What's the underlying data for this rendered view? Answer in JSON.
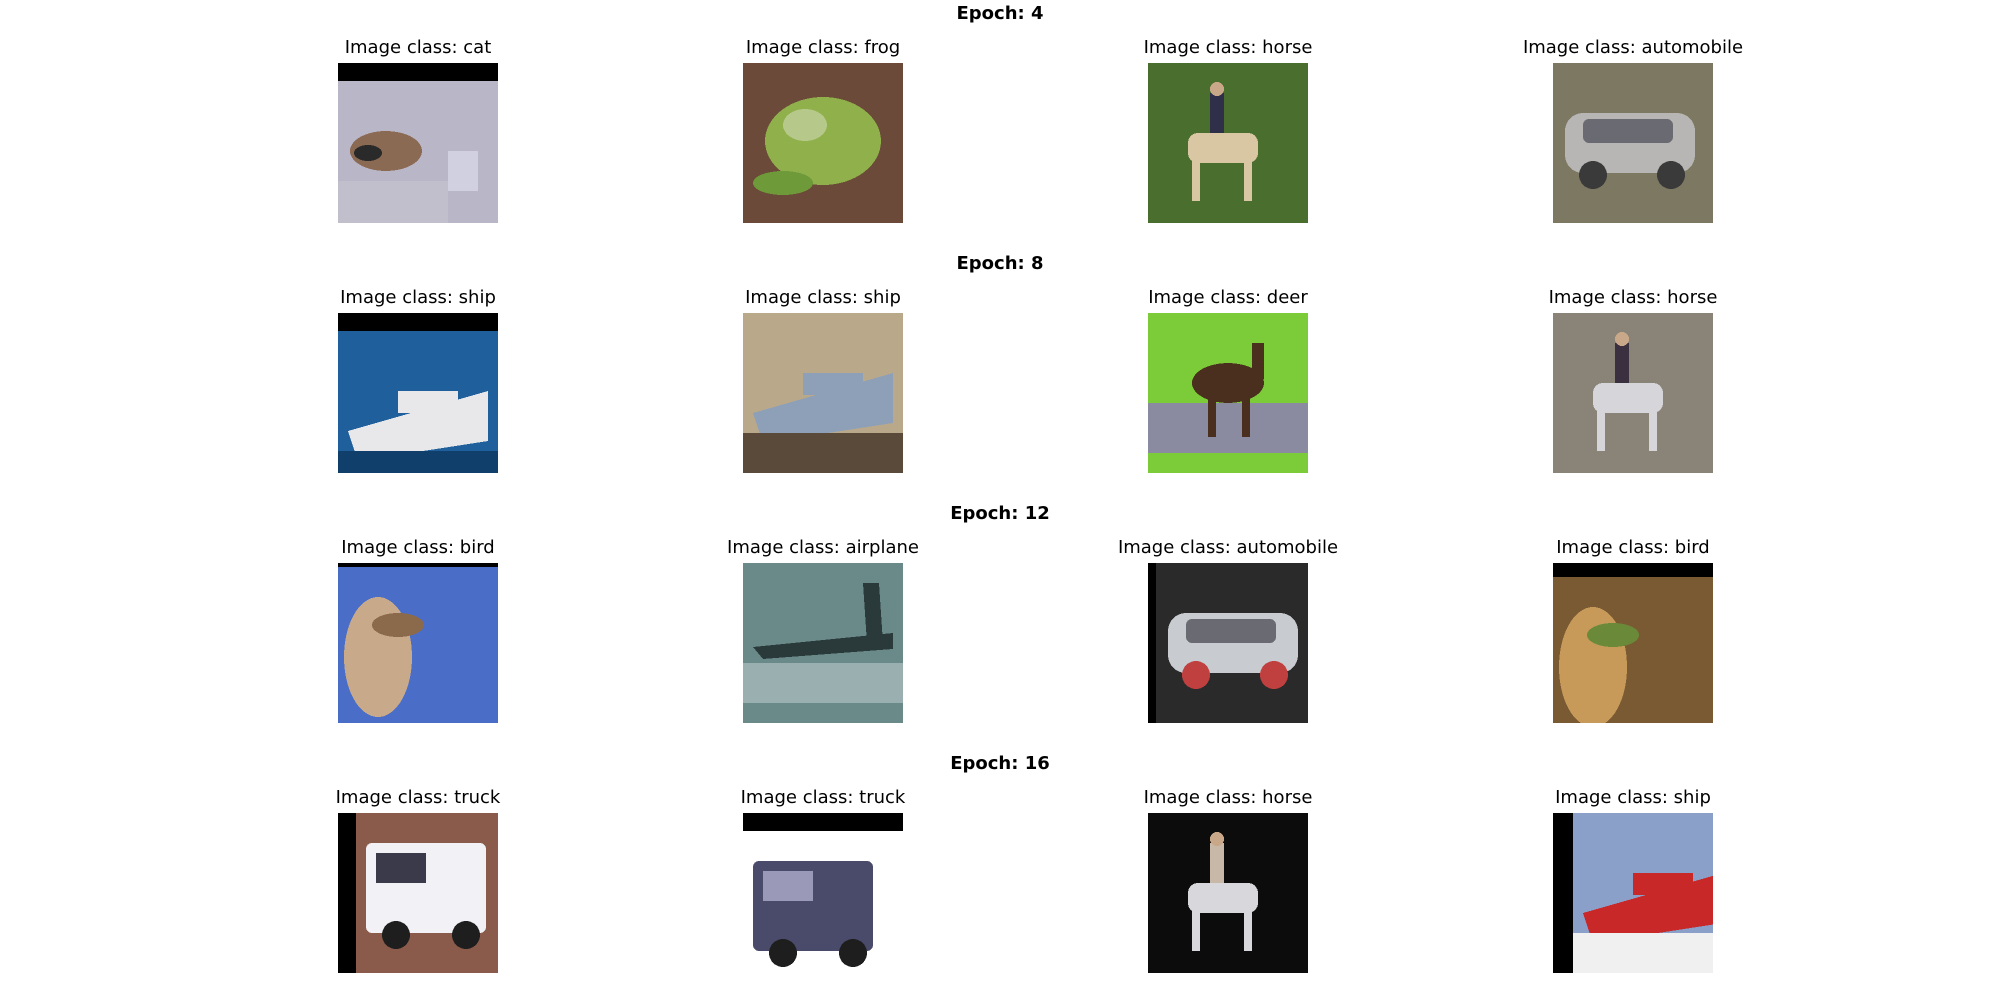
{
  "figure": {
    "rows": [
      {
        "title": "Epoch: 4",
        "cells": [
          {
            "label": "Image class: cat",
            "subject": "cat",
            "bg": "#b9b6c8",
            "fg": "#8a6a52",
            "accent": "#2a2a2a"
          },
          {
            "label": "Image class: frog",
            "subject": "frog",
            "bg": "#6b4a3a",
            "fg": "#8fb04a",
            "accent": "#b6c98a"
          },
          {
            "label": "Image class: horse",
            "subject": "horse",
            "bg": "#4a6e2e",
            "fg": "#d8c7a2",
            "accent": "#2f2f4a"
          },
          {
            "label": "Image class: automobile",
            "subject": "automobile",
            "bg": "#7c7862",
            "fg": "#b8b6b4",
            "accent": "#3a3a3a"
          }
        ]
      },
      {
        "title": "Epoch: 8",
        "cells": [
          {
            "label": "Image class: ship",
            "subject": "ship",
            "bg": "#1f5f9c",
            "fg": "#e8e8ea",
            "accent": "#0f3f6a"
          },
          {
            "label": "Image class: ship",
            "subject": "ship",
            "bg": "#b9a98a",
            "fg": "#8ea0b8",
            "accent": "#5a4a3a"
          },
          {
            "label": "Image class: deer",
            "subject": "deer",
            "bg": "#7ccc3a",
            "fg": "#4a2e1e",
            "accent": "#8a8aa0"
          },
          {
            "label": "Image class: horse",
            "subject": "horse",
            "bg": "#8a8478",
            "fg": "#d6d6da",
            "accent": "#3a3040"
          }
        ]
      },
      {
        "title": "Epoch: 12",
        "cells": [
          {
            "label": "Image class: bird",
            "subject": "bird",
            "bg": "#4a6ec8",
            "fg": "#c8aa8a",
            "accent": "#8a6a4a"
          },
          {
            "label": "Image class: airplane",
            "subject": "airplane",
            "bg": "#6a8a8a",
            "fg": "#2a3a3a",
            "accent": "#9ab0b0"
          },
          {
            "label": "Image class: automobile",
            "subject": "automobile",
            "bg": "#2a2a2a",
            "fg": "#c8ccd0",
            "accent": "#c04040"
          },
          {
            "label": "Image class: bird",
            "subject": "bird",
            "bg": "#7a5a32",
            "fg": "#c89a5a",
            "accent": "#6a8a3a"
          }
        ]
      },
      {
        "title": "Epoch: 16",
        "cells": [
          {
            "label": "Image class: truck",
            "subject": "truck",
            "bg": "#8a5a4a",
            "fg": "#f2f2f6",
            "accent": "#3a3a4a"
          },
          {
            "label": "Image class: truck",
            "subject": "truck",
            "bg": "#ffffff",
            "fg": "#4a4a6a",
            "accent": "#9a9ab8"
          },
          {
            "label": "Image class: horse",
            "subject": "horse",
            "bg": "#0c0c0c",
            "fg": "#d8d8dc",
            "accent": "#c8b8a8"
          },
          {
            "label": "Image class: ship",
            "subject": "ship",
            "bg": "#8aa0c8",
            "fg": "#c82828",
            "accent": "#f0f0f0"
          }
        ]
      }
    ]
  }
}
